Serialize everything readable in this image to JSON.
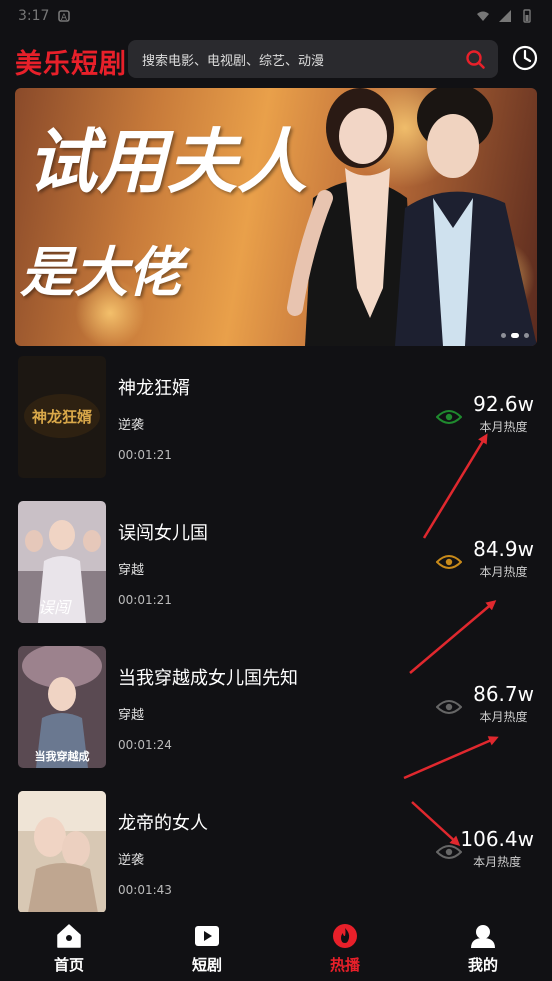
{
  "status_bar": {
    "time": "3:17"
  },
  "header": {
    "app_name": "美乐短剧",
    "search_placeholder": "搜索电影、电视剧、综艺、动漫"
  },
  "banner": {
    "title_line1": "试用夫人",
    "title_line2": "是大佬",
    "dots": 3,
    "active_dot": 1
  },
  "items": [
    {
      "title": "神龙狂婿",
      "tag": "逆袭",
      "duration": "00:01:21",
      "heat": "92.6w",
      "heat_label": "本月热度",
      "thumb_text": "神龙狂婿",
      "eye_color": "#1f8a2e"
    },
    {
      "title": "误闯女儿国",
      "tag": "穿越",
      "duration": "00:01:21",
      "heat": "84.9w",
      "heat_label": "本月热度",
      "thumb_text": "误闯女儿国",
      "eye_color": "#c88a1a"
    },
    {
      "title": "当我穿越成女儿国先知",
      "tag": "穿越",
      "duration": "00:01:24",
      "heat": "86.7w",
      "heat_label": "本月热度",
      "thumb_text": "当我穿越成",
      "eye_color": "#666666"
    },
    {
      "title": "龙帝的女人",
      "tag": "逆袭",
      "duration": "00:01:43",
      "heat": "106.4w",
      "heat_label": "本月热度",
      "thumb_text": "",
      "eye_color": "#666666"
    }
  ],
  "tabs": [
    {
      "label": "首页",
      "icon": "home-icon",
      "active": false
    },
    {
      "label": "短剧",
      "icon": "play-icon",
      "active": false
    },
    {
      "label": "热播",
      "icon": "fire-icon",
      "active": true
    },
    {
      "label": "我的",
      "icon": "user-icon",
      "active": false
    }
  ],
  "colors": {
    "accent": "#e8202a",
    "background": "#111114",
    "search_bg": "#2a2a2e",
    "annotation_arrow": "#e0282e"
  }
}
